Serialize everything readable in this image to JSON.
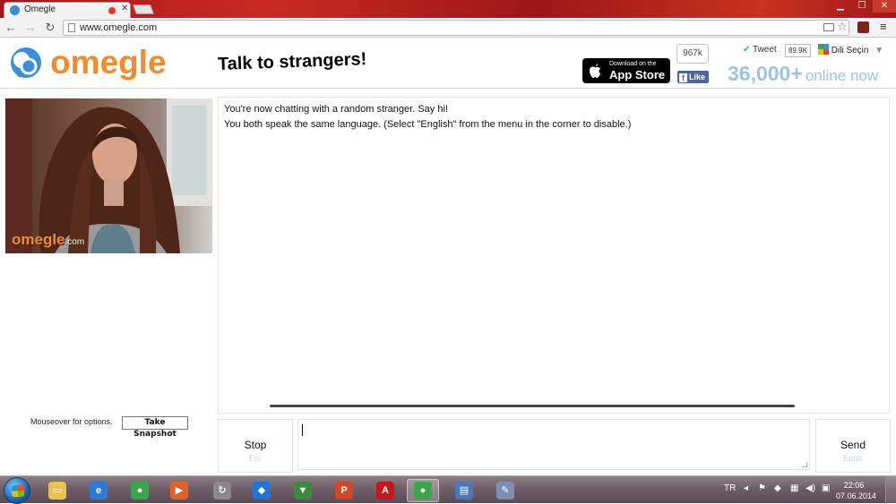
{
  "browser": {
    "tab_title": "Omegle",
    "tab_close": "✕",
    "url": "www.omegle.com",
    "window_controls": {
      "minimize": "▁",
      "maximize": "❐",
      "close": "✕"
    },
    "menu_icon": "≡"
  },
  "header": {
    "logo_text": "omegle",
    "tagline": "Talk to strangers!",
    "app_store": {
      "small": "Download on the",
      "big": "App Store"
    },
    "facebook": {
      "count": "967k",
      "like_label": "Like"
    },
    "twitter": {
      "label": "Tweet",
      "count": "89.9K"
    },
    "language": {
      "label": "Dili Seçin",
      "caret": "▼"
    },
    "online": {
      "count": "36,000+",
      "label": "online now"
    }
  },
  "video": {
    "watermark": "omegle",
    "watermark_suffix": ".com"
  },
  "chat": {
    "status_lines": [
      "You're now chatting with a random stranger. Say hi!",
      "You both speak the same language. (Select \"English\" from the menu in the corner to disable.)"
    ],
    "mouseover_hint": "Mouseover for options.",
    "snapshot_button": "Take Snapshot",
    "stop": {
      "label": "Stop",
      "key": "Esc"
    },
    "send": {
      "label": "Send",
      "key": "Enter"
    }
  },
  "taskbar": {
    "apps": [
      {
        "name": "explorer",
        "color": "#e8c250",
        "glyph": "▭"
      },
      {
        "name": "internet-explorer",
        "color": "#2a7bd8",
        "glyph": "e"
      },
      {
        "name": "chrome",
        "color": "#3aa64a",
        "glyph": "●"
      },
      {
        "name": "media-player",
        "color": "#e0622a",
        "glyph": "▶"
      },
      {
        "name": "sync-app",
        "color": "#8a8a8a",
        "glyph": "↻"
      },
      {
        "name": "dropbox",
        "color": "#1d74d8",
        "glyph": "◆"
      },
      {
        "name": "downloader",
        "color": "#3c8a3c",
        "glyph": "▼"
      },
      {
        "name": "powerpoint",
        "color": "#d24726",
        "glyph": "P"
      },
      {
        "name": "acrobat",
        "color": "#c8161d",
        "glyph": "A"
      },
      {
        "name": "chrome-active",
        "color": "#3aa64a",
        "glyph": "●"
      },
      {
        "name": "network-app",
        "color": "#4a78b8",
        "glyph": "▤"
      },
      {
        "name": "paint",
        "color": "#7c8fb0",
        "glyph": "✎"
      }
    ],
    "tray_lang": "TR",
    "time": "22:06",
    "date": "07.06.2014"
  }
}
